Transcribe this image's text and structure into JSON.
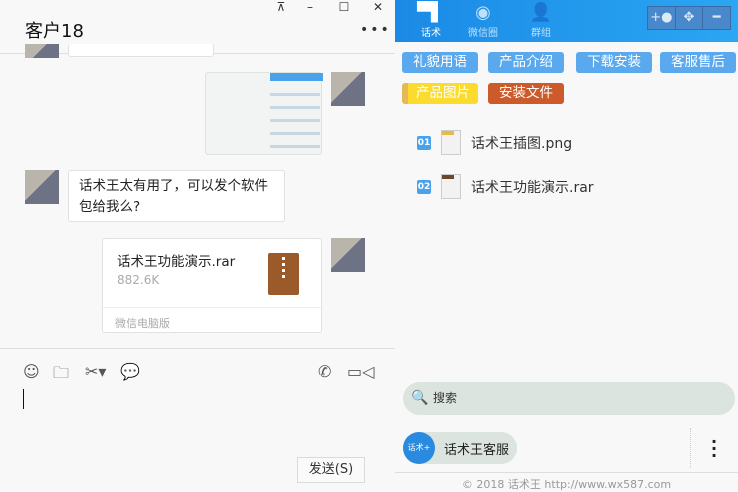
{
  "window": {
    "pin": "⊼",
    "minimize": "–",
    "maximize": "☐",
    "close": "✕"
  },
  "chat": {
    "title": "客户18",
    "more": "•••",
    "messages": [
      {
        "type": "image",
        "from": "me"
      },
      {
        "type": "text",
        "from": "customer",
        "text": "话术王太有用了，可以发个软件包给我么?"
      },
      {
        "type": "file",
        "from": "me",
        "file_name": "话术王功能演示.rar",
        "file_size": "882.6K",
        "source": "微信电脑版"
      }
    ],
    "send_label": "发送(S)"
  },
  "panel": {
    "tabs": [
      {
        "label": "话术",
        "active": true
      },
      {
        "label": "微信圈"
      },
      {
        "label": "群组"
      }
    ],
    "tags": [
      {
        "label": "礼貌用语",
        "color": "#5aa9ee"
      },
      {
        "label": "产品介绍",
        "color": "#5aa9ee"
      },
      {
        "label": "下载安装",
        "color": "#5aa9ee"
      },
      {
        "label": "客服售后",
        "color": "#5aa9ee"
      },
      {
        "label": "产品图片",
        "color": "#fbdc2e"
      },
      {
        "label": "安装文件",
        "color": "#cd5a2b"
      }
    ],
    "files": [
      {
        "num": "01",
        "name": "话术王插图.png"
      },
      {
        "num": "02",
        "name": "话术王功能演示.rar"
      }
    ],
    "search_placeholder": "搜索",
    "contact": {
      "name": "话术王客服",
      "avatar_text": "话术+"
    },
    "footer": "© 2018 话术王 http://www.wx587.com"
  }
}
